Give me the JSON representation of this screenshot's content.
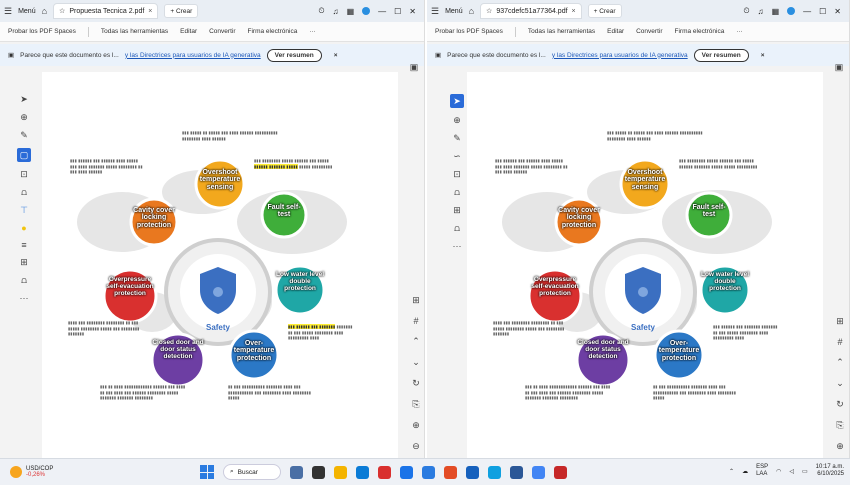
{
  "left_window": {
    "tab_title": "Propuesta Tecnica 2.pdf",
    "new_tab": "+ Crear",
    "banner_text": "Parece que este documento es l...",
    "banner_link": "y las Directrices para usuarios de IA generativa",
    "summary_button": "Ver resumen"
  },
  "right_window": {
    "tab_title": "937cdefc51a77364.pdf",
    "new_tab": "+ Crear",
    "banner_text": "Parece que este documento es l...",
    "banner_link": "y las Directrices para usuarios de IA generativa",
    "summary_button": "Ver resumen"
  },
  "toolbar": {
    "menu": "Menú",
    "item1": "Probar los PDF Spaces",
    "item2": "Todas las herramientas",
    "item3": "Editar",
    "item4": "Convertir",
    "item5": "Firma electrónica",
    "more": "···"
  },
  "diagram": {
    "center_label": "Safety",
    "nodes": [
      {
        "label": "Overshoot temperature sensing",
        "color": "#f2a81d"
      },
      {
        "label": "Fault self-test",
        "color": "#3fae3a"
      },
      {
        "label": "Low water level double protection",
        "color": "#1fa7a6"
      },
      {
        "label": "Over-temperature protection",
        "color": "#2b78c6"
      },
      {
        "label": "Closed door and door status detection",
        "color": "#6d3ea3"
      },
      {
        "label": "Overpressure self-evacuation protection",
        "color": "#d9302f"
      },
      {
        "label": "Cavity cover locking protection",
        "color": "#e9781f"
      }
    ],
    "accent_color": "#e0e0e0",
    "shield_color": "#3b6fc1"
  },
  "taskbar": {
    "weather_label": "USD/COP",
    "weather_value": "-0,26%",
    "search_placeholder": "Buscar",
    "lang": "ESP",
    "lang2": "LAA",
    "time": "10:17 a.m.",
    "date": "6/10/2025"
  }
}
